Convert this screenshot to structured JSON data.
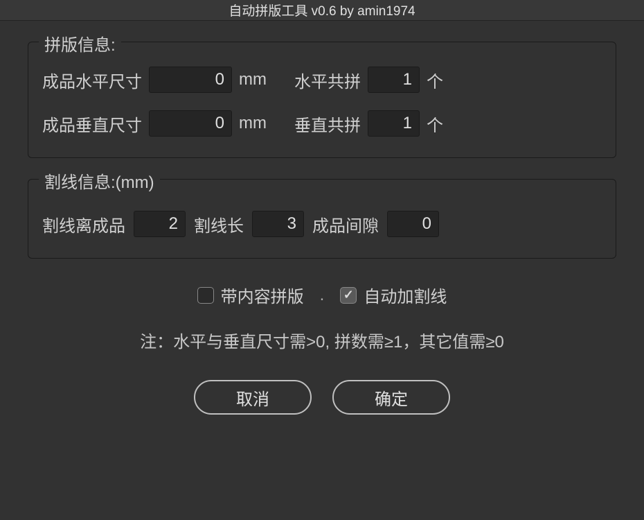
{
  "window": {
    "title": "自动拼版工具 v0.6   by amin1974"
  },
  "panel1": {
    "legend": "拼版信息:",
    "horiz_size_label": "成品水平尺寸",
    "horiz_size_value": "0",
    "horiz_size_unit": "mm",
    "horiz_count_label": "水平共拼",
    "horiz_count_value": "1",
    "horiz_count_unit": "个",
    "vert_size_label": "成品垂直尺寸",
    "vert_size_value": "0",
    "vert_size_unit": "mm",
    "vert_count_label": "垂直共拼",
    "vert_count_value": "1",
    "vert_count_unit": "个"
  },
  "panel2": {
    "legend": "割线信息:(mm)",
    "offset_label": "割线离成品",
    "offset_value": "2",
    "length_label": "割线长",
    "length_value": "3",
    "gap_label": "成品间隙",
    "gap_value": "0"
  },
  "checkboxes": {
    "with_content_label": "带内容拼版",
    "with_content_checked": false,
    "separator": ".",
    "auto_cutline_label": "自动加割线",
    "auto_cutline_checked": true
  },
  "note": "注：水平与垂直尺寸需>0, 拼数需≥1，其它值需≥0",
  "buttons": {
    "cancel": "取消",
    "ok": "确定"
  }
}
